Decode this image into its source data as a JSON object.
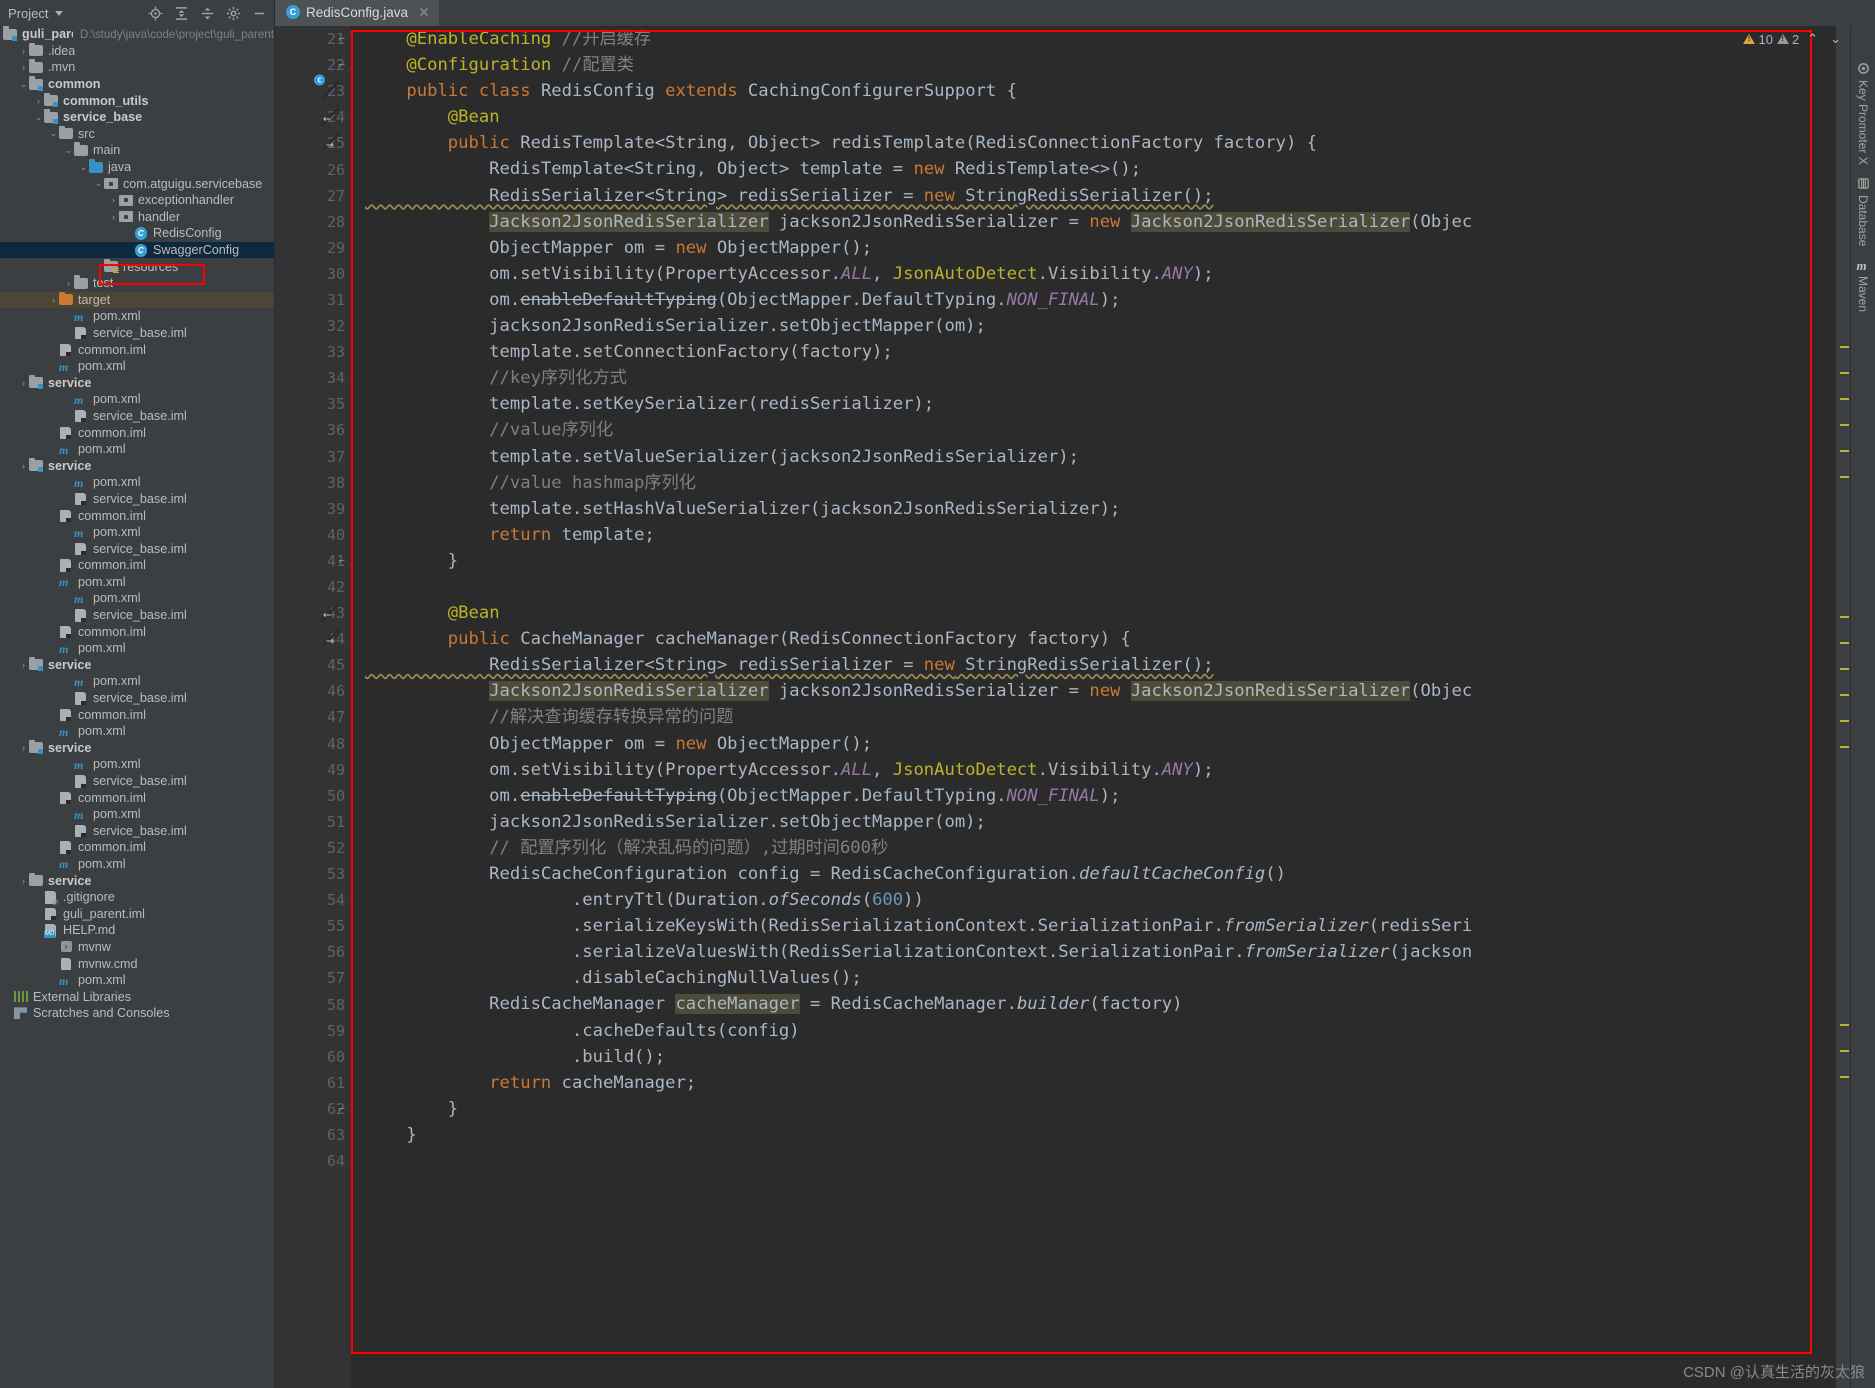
{
  "window": {
    "project_panel_title": "Project",
    "editor_tab": {
      "label": "RedisConfig.java",
      "icon": "java-class-icon",
      "close": "✕"
    }
  },
  "panel_toolbar": [
    {
      "name": "locate-icon",
      "glyph": "⊕"
    },
    {
      "name": "expand-all-icon",
      "glyph": "⇱"
    },
    {
      "name": "collapse-all-icon",
      "glyph": "⇲"
    },
    {
      "name": "gear-icon",
      "glyph": "⚙"
    },
    {
      "name": "hide-icon",
      "glyph": "—"
    }
  ],
  "tree": {
    "root": {
      "label": "guli_parent",
      "path": "D:\\study\\java\\code\\project\\guli_parent"
    },
    "items": [
      {
        "label": ".idea",
        "indent": 1,
        "arrow": "›",
        "icon": "folder",
        "bold": false
      },
      {
        "label": ".mvn",
        "indent": 1,
        "arrow": "›",
        "icon": "folder",
        "bold": false
      },
      {
        "label": "common",
        "indent": 1,
        "arrow": "⌄",
        "icon": "folder-mod",
        "bold": true
      },
      {
        "label": "common_utils",
        "indent": 2,
        "arrow": "›",
        "icon": "folder-mod",
        "bold": true
      },
      {
        "label": "service_base",
        "indent": 2,
        "arrow": "⌄",
        "icon": "folder-mod",
        "bold": true
      },
      {
        "label": "src",
        "indent": 3,
        "arrow": "⌄",
        "icon": "folder",
        "bold": false
      },
      {
        "label": "main",
        "indent": 4,
        "arrow": "⌄",
        "icon": "folder",
        "bold": false
      },
      {
        "label": "java",
        "indent": 5,
        "arrow": "⌄",
        "icon": "folder-src",
        "bold": false
      },
      {
        "label": "com.atguigu.servicebase",
        "indent": 6,
        "arrow": "⌄",
        "icon": "package",
        "bold": false
      },
      {
        "label": "exceptionhandler",
        "indent": 7,
        "arrow": "›",
        "icon": "package",
        "bold": false
      },
      {
        "label": "handler",
        "indent": 7,
        "arrow": "›",
        "icon": "package",
        "bold": false
      },
      {
        "label": "RedisConfig",
        "indent": 8,
        "arrow": "",
        "icon": "class",
        "bold": false
      },
      {
        "label": "SwaggerConfig",
        "indent": 8,
        "arrow": "",
        "icon": "class",
        "bold": false,
        "selected": true,
        "highlighted": true
      },
      {
        "label": "resources",
        "indent": 6,
        "arrow": "",
        "icon": "folder-res",
        "bold": false
      },
      {
        "label": "test",
        "indent": 4,
        "arrow": "›",
        "icon": "folder",
        "bold": false
      },
      {
        "label": "target",
        "indent": 3,
        "arrow": "›",
        "icon": "folder-orange",
        "bold": false,
        "target_row": true
      },
      {
        "label": "pom.xml",
        "indent": 4,
        "arrow": "",
        "icon": "maven",
        "bold": false
      },
      {
        "label": "service_base.iml",
        "indent": 4,
        "arrow": "",
        "icon": "iml",
        "bold": false
      },
      {
        "label": "common.iml",
        "indent": 3,
        "arrow": "",
        "icon": "iml",
        "bold": false
      },
      {
        "label": "pom.xml",
        "indent": 3,
        "arrow": "",
        "icon": "maven",
        "bold": false
      },
      {
        "label": "service",
        "indent": 1,
        "arrow": "›",
        "icon": "folder-mod",
        "bold": true
      },
      {
        "label": "pom.xml",
        "indent": 4,
        "arrow": "",
        "icon": "maven",
        "bold": false
      },
      {
        "label": "service_base.iml",
        "indent": 4,
        "arrow": "",
        "icon": "iml",
        "bold": false
      },
      {
        "label": "common.iml",
        "indent": 3,
        "arrow": "",
        "icon": "iml",
        "bold": false
      },
      {
        "label": "pom.xml",
        "indent": 3,
        "arrow": "",
        "icon": "maven",
        "bold": false
      },
      {
        "label": "service",
        "indent": 1,
        "arrow": "›",
        "icon": "folder-mod",
        "bold": true
      },
      {
        "label": "pom.xml",
        "indent": 4,
        "arrow": "",
        "icon": "maven",
        "bold": false
      },
      {
        "label": "service_base.iml",
        "indent": 4,
        "arrow": "",
        "icon": "iml",
        "bold": false
      },
      {
        "label": "common.iml",
        "indent": 3,
        "arrow": "",
        "icon": "iml",
        "bold": false
      },
      {
        "label": "pom.xml",
        "indent": 4,
        "arrow": "",
        "icon": "maven",
        "bold": false
      },
      {
        "label": "service_base.iml",
        "indent": 4,
        "arrow": "",
        "icon": "iml",
        "bold": false
      },
      {
        "label": "common.iml",
        "indent": 3,
        "arrow": "",
        "icon": "iml",
        "bold": false
      },
      {
        "label": "pom.xml",
        "indent": 3,
        "arrow": "",
        "icon": "maven",
        "bold": false
      },
      {
        "label": "pom.xml",
        "indent": 4,
        "arrow": "",
        "icon": "maven",
        "bold": false
      },
      {
        "label": "service_base.iml",
        "indent": 4,
        "arrow": "",
        "icon": "iml",
        "bold": false
      },
      {
        "label": "common.iml",
        "indent": 3,
        "arrow": "",
        "icon": "iml",
        "bold": false
      },
      {
        "label": "pom.xml",
        "indent": 3,
        "arrow": "",
        "icon": "maven",
        "bold": false
      },
      {
        "label": "service",
        "indent": 1,
        "arrow": "›",
        "icon": "folder-mod",
        "bold": true
      },
      {
        "label": "pom.xml",
        "indent": 4,
        "arrow": "",
        "icon": "maven",
        "bold": false
      },
      {
        "label": "service_base.iml",
        "indent": 4,
        "arrow": "",
        "icon": "iml",
        "bold": false
      },
      {
        "label": "common.iml",
        "indent": 3,
        "arrow": "",
        "icon": "iml",
        "bold": false
      },
      {
        "label": "pom.xml",
        "indent": 3,
        "arrow": "",
        "icon": "maven",
        "bold": false
      },
      {
        "label": "service",
        "indent": 1,
        "arrow": "›",
        "icon": "folder-mod",
        "bold": true
      },
      {
        "label": "pom.xml",
        "indent": 4,
        "arrow": "",
        "icon": "maven",
        "bold": false
      },
      {
        "label": "service_base.iml",
        "indent": 4,
        "arrow": "",
        "icon": "iml",
        "bold": false
      },
      {
        "label": "common.iml",
        "indent": 3,
        "arrow": "",
        "icon": "iml",
        "bold": false
      },
      {
        "label": "pom.xml",
        "indent": 4,
        "arrow": "",
        "icon": "maven",
        "bold": false
      },
      {
        "label": "service_base.iml",
        "indent": 4,
        "arrow": "",
        "icon": "iml",
        "bold": false
      },
      {
        "label": "common.iml",
        "indent": 3,
        "arrow": "",
        "icon": "iml",
        "bold": false
      },
      {
        "label": "pom.xml",
        "indent": 3,
        "arrow": "",
        "icon": "maven",
        "bold": false
      },
      {
        "label": "service",
        "indent": 1,
        "arrow": "›",
        "icon": "folder",
        "bold": true
      },
      {
        "label": ".gitignore",
        "indent": 2,
        "arrow": "",
        "icon": "gitignore",
        "bold": false
      },
      {
        "label": "guli_parent.iml",
        "indent": 2,
        "arrow": "",
        "icon": "iml",
        "bold": false
      },
      {
        "label": "HELP.md",
        "indent": 2,
        "arrow": "",
        "icon": "md",
        "bold": false
      },
      {
        "label": "mvnw",
        "indent": 3,
        "arrow": "",
        "icon": "shell",
        "bold": false
      },
      {
        "label": "mvnw.cmd",
        "indent": 3,
        "arrow": "",
        "icon": "cmd",
        "bold": false
      },
      {
        "label": "pom.xml",
        "indent": 3,
        "arrow": "",
        "icon": "maven",
        "bold": false
      },
      {
        "label": "External Libraries",
        "indent": 0,
        "arrow": "",
        "icon": "library",
        "bold": false
      },
      {
        "label": "Scratches and Consoles",
        "indent": 0,
        "arrow": "",
        "icon": "scratches",
        "bold": false
      }
    ]
  },
  "inspections": {
    "warning_count": "10",
    "weak_warning_count": "2",
    "prev_glyph": "⌃",
    "next_glyph": "⌄"
  },
  "right_tool_tabs": [
    {
      "label": "Key Promoter X",
      "icon": "key-promoter-icon"
    },
    {
      "label": "Database",
      "icon": "database-icon"
    },
    {
      "label": "Maven",
      "icon": "maven-icon"
    }
  ],
  "watermark": "CSDN @认真生活的灰太狼",
  "colors": {
    "editor_bg": "#2b2b2b",
    "panel_bg": "#3c3f41",
    "gutter_bg": "#313335",
    "selection": "#0d293e",
    "annotation_red": "#ff0000",
    "keyword": "#cc7832",
    "annotation_yellow": "#bbb529",
    "comment": "#808080",
    "number": "#6897bb",
    "static_field": "#9876aa",
    "identifier": "#a9b7c6",
    "highlight_token": "#4e4b38"
  },
  "code": {
    "first_line_number": 21,
    "lines": [
      {
        "n": 21,
        "gutter": "fold-end",
        "text": "    @EnableCaching //开启缓存"
      },
      {
        "n": 22,
        "gutter": "fold-end",
        "text": "    @Configuration //配置类"
      },
      {
        "n": 23,
        "gutter": "run-class",
        "text": "    public class RedisConfig extends CachingConfigurerSupport {"
      },
      {
        "n": 24,
        "gutter": "bean-left",
        "text": "        @Bean"
      },
      {
        "n": 25,
        "gutter": "bean-right",
        "text": "        public RedisTemplate<String, Object> redisTemplate(RedisConnectionFactory factory) {"
      },
      {
        "n": 26,
        "gutter": "",
        "text": "            RedisTemplate<String, Object> template = new RedisTemplate<>();"
      },
      {
        "n": 27,
        "gutter": "",
        "text": "            RedisSerializer<String> redisSerializer = new StringRedisSerializer();"
      },
      {
        "n": 28,
        "gutter": "",
        "text": "            Jackson2JsonRedisSerializer jackson2JsonRedisSerializer = new Jackson2JsonRedisSerializer(Objec"
      },
      {
        "n": 29,
        "gutter": "",
        "text": "            ObjectMapper om = new ObjectMapper();"
      },
      {
        "n": 30,
        "gutter": "",
        "text": "            om.setVisibility(PropertyAccessor.ALL, JsonAutoDetect.Visibility.ANY);"
      },
      {
        "n": 31,
        "gutter": "",
        "text": "            om.enableDefaultTyping(ObjectMapper.DefaultTyping.NON_FINAL);"
      },
      {
        "n": 32,
        "gutter": "",
        "text": "            jackson2JsonRedisSerializer.setObjectMapper(om);"
      },
      {
        "n": 33,
        "gutter": "",
        "text": "            template.setConnectionFactory(factory);"
      },
      {
        "n": 34,
        "gutter": "",
        "text": "            //key序列化方式"
      },
      {
        "n": 35,
        "gutter": "",
        "text": "            template.setKeySerializer(redisSerializer);"
      },
      {
        "n": 36,
        "gutter": "",
        "text": "            //value序列化"
      },
      {
        "n": 37,
        "gutter": "",
        "text": "            template.setValueSerializer(jackson2JsonRedisSerializer);"
      },
      {
        "n": 38,
        "gutter": "",
        "text": "            //value hashmap序列化"
      },
      {
        "n": 39,
        "gutter": "",
        "text": "            template.setHashValueSerializer(jackson2JsonRedisSerializer);"
      },
      {
        "n": 40,
        "gutter": "",
        "text": "            return template;"
      },
      {
        "n": 41,
        "gutter": "fold-close",
        "text": "        }"
      },
      {
        "n": 42,
        "gutter": "",
        "text": ""
      },
      {
        "n": 43,
        "gutter": "bean-left",
        "text": "        @Bean"
      },
      {
        "n": 44,
        "gutter": "bean-right",
        "text": "        public CacheManager cacheManager(RedisConnectionFactory factory) {"
      },
      {
        "n": 45,
        "gutter": "",
        "text": "            RedisSerializer<String> redisSerializer = new StringRedisSerializer();"
      },
      {
        "n": 46,
        "gutter": "",
        "text": "            Jackson2JsonRedisSerializer jackson2JsonRedisSerializer = new Jackson2JsonRedisSerializer(Objec"
      },
      {
        "n": 47,
        "gutter": "",
        "text": "            //解决查询缓存转换异常的问题"
      },
      {
        "n": 48,
        "gutter": "",
        "text": "            ObjectMapper om = new ObjectMapper();"
      },
      {
        "n": 49,
        "gutter": "",
        "text": "            om.setVisibility(PropertyAccessor.ALL, JsonAutoDetect.Visibility.ANY);"
      },
      {
        "n": 50,
        "gutter": "",
        "text": "            om.enableDefaultTyping(ObjectMapper.DefaultTyping.NON_FINAL);"
      },
      {
        "n": 51,
        "gutter": "",
        "text": "            jackson2JsonRedisSerializer.setObjectMapper(om);"
      },
      {
        "n": 52,
        "gutter": "",
        "text": "            // 配置序列化（解决乱码的问题）,过期时间600秒"
      },
      {
        "n": 53,
        "gutter": "",
        "text": "            RedisCacheConfiguration config = RedisCacheConfiguration.defaultCacheConfig()"
      },
      {
        "n": 54,
        "gutter": "",
        "text": "                    .entryTtl(Duration.ofSeconds(600))"
      },
      {
        "n": 55,
        "gutter": "",
        "text": "                    .serializeKeysWith(RedisSerializationContext.SerializationPair.fromSerializer(redisSeri"
      },
      {
        "n": 56,
        "gutter": "",
        "text": "                    .serializeValuesWith(RedisSerializationContext.SerializationPair.fromSerializer(jackson"
      },
      {
        "n": 57,
        "gutter": "",
        "text": "                    .disableCachingNullValues();"
      },
      {
        "n": 58,
        "gutter": "",
        "text": "            RedisCacheManager cacheManager = RedisCacheManager.builder(factory)"
      },
      {
        "n": 59,
        "gutter": "",
        "text": "                    .cacheDefaults(config)"
      },
      {
        "n": 60,
        "gutter": "",
        "text": "                    .build();"
      },
      {
        "n": 61,
        "gutter": "",
        "text": "            return cacheManager;"
      },
      {
        "n": 62,
        "gutter": "fold-close",
        "text": "        }"
      },
      {
        "n": 63,
        "gutter": "",
        "text": "    }"
      },
      {
        "n": 64,
        "gutter": "",
        "text": ""
      }
    ]
  }
}
